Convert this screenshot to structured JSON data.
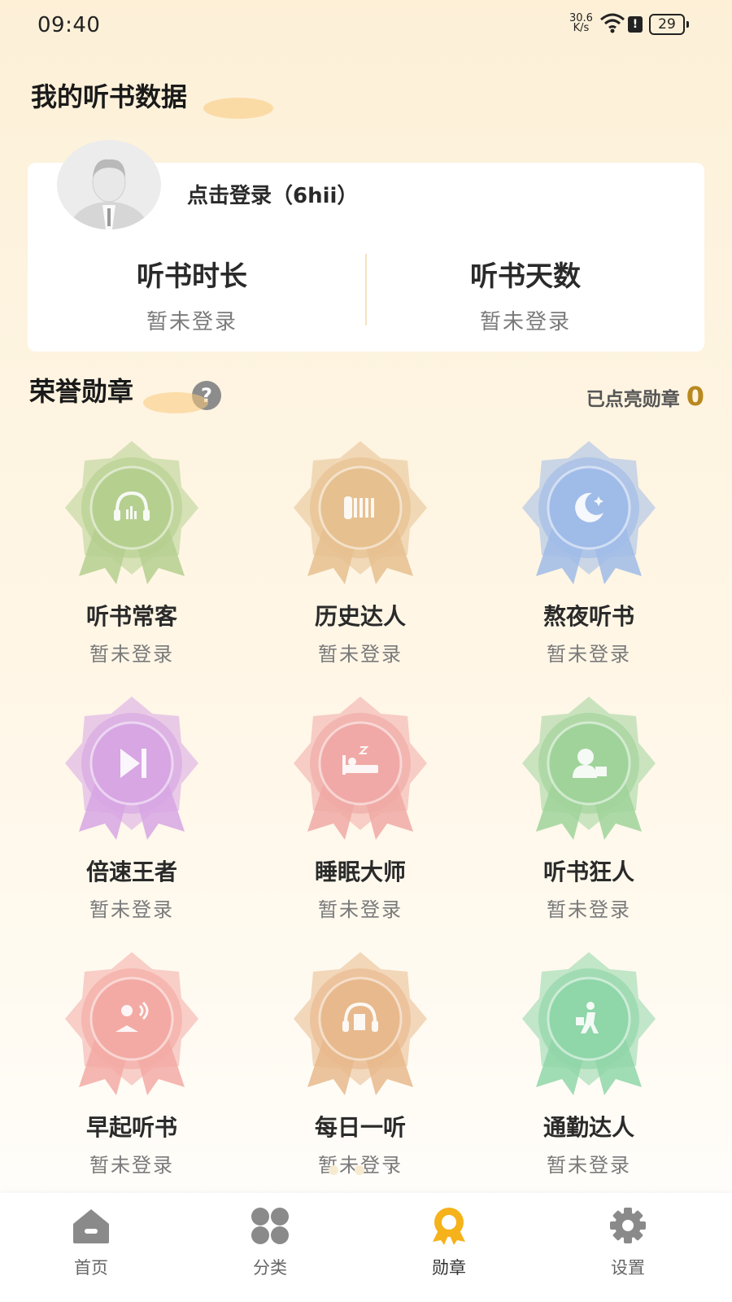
{
  "status_bar": {
    "time": "09:40",
    "net_speed_value": "30.6",
    "net_speed_unit": "K/s",
    "battery": "29"
  },
  "profile": {
    "section_title": "我的听书数据",
    "login_text": "点击登录（6hii）",
    "stats": [
      {
        "label": "听书时长",
        "value": "暂未登录"
      },
      {
        "label": "听书天数",
        "value": "暂未登录"
      }
    ]
  },
  "medals": {
    "section_title": "荣誉勋章",
    "help": "?",
    "lit_label": "已点亮勋章",
    "lit_count": "0",
    "items": [
      {
        "name": "听书常客",
        "status": "暂未登录",
        "icon": "headphones-icon",
        "color": "#b5cf8f"
      },
      {
        "name": "历史达人",
        "status": "暂未登录",
        "icon": "scroll-icon",
        "color": "#e6c08f"
      },
      {
        "name": "熬夜听书",
        "status": "暂未登录",
        "icon": "moon-icon",
        "color": "#9fbbe8"
      },
      {
        "name": "倍速王者",
        "status": "暂未登录",
        "icon": "fast-forward-icon",
        "color": "#d7a6e3"
      },
      {
        "name": "睡眠大师",
        "status": "暂未登录",
        "icon": "sleep-icon",
        "color": "#f0a9a6"
      },
      {
        "name": "听书狂人",
        "status": "暂未登录",
        "icon": "listener-icon",
        "color": "#9fd39a"
      },
      {
        "name": "早起听书",
        "status": "暂未登录",
        "icon": "reading-icon",
        "color": "#f3aaa4"
      },
      {
        "name": "每日一听",
        "status": "暂未登录",
        "icon": "daily-headphones-icon",
        "color": "#e8b98c"
      },
      {
        "name": "通勤达人",
        "status": "暂未登录",
        "icon": "commuter-icon",
        "color": "#8fd6a8"
      }
    ]
  },
  "carousel": {
    "page_count": 3,
    "active_index": 2
  },
  "nav": [
    {
      "label": "首页",
      "icon": "home-icon"
    },
    {
      "label": "分类",
      "icon": "category-icon"
    },
    {
      "label": "勋章",
      "icon": "medal-icon",
      "active": true
    },
    {
      "label": "设置",
      "icon": "settings-icon"
    }
  ],
  "colors": {
    "accent": "#f5b21b",
    "nav_inactive": "#8a8a8a",
    "lit_count": "#b8891f"
  }
}
